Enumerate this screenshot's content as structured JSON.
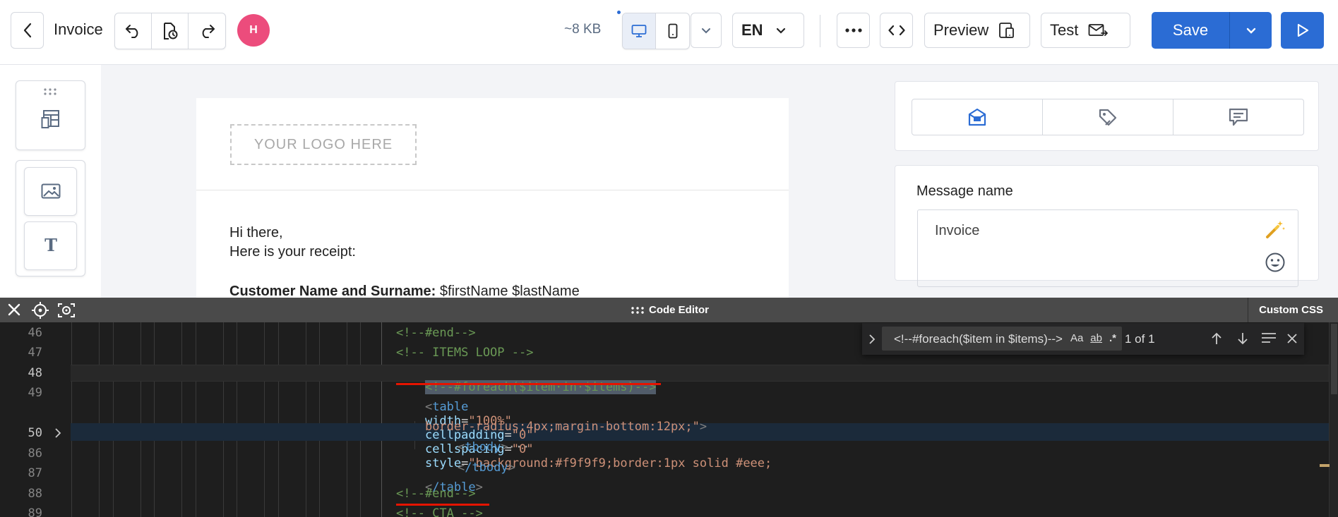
{
  "topbar": {
    "title": "Invoice",
    "avatar_initial": "H",
    "size": "~8 KB",
    "language": "EN",
    "preview_label": "Preview",
    "test_label": "Test",
    "save_label": "Save"
  },
  "canvas": {
    "logo_placeholder": "YOUR LOGO HERE",
    "greeting": "Hi there,",
    "receipt_line": "Here is your receipt:",
    "customer_label": "Customer Name and Surname:",
    "customer_value": "$firstName $lastName"
  },
  "settings": {
    "message_name_label": "Message name",
    "message_name_value": "Invoice"
  },
  "code_editor": {
    "title": "Code Editor",
    "custom_css_label": "Custom CSS",
    "find": {
      "query": "<!--#foreach($item in $items)-->",
      "match_case": "Aa",
      "whole_word": "ab",
      "regex": ".*",
      "count": "1 of 1"
    },
    "lines": [
      {
        "num": "46",
        "text": "<!--#end-->"
      },
      {
        "num": "47",
        "text": "<!-- ITEMS LOOP -->"
      },
      {
        "num": "48",
        "text": "<!--#foreach($item·in·$items)-->"
      },
      {
        "num": "49",
        "tag": "table",
        "attrs": [
          {
            "name": "width",
            "value": "\"100%\""
          },
          {
            "name": "cellpadding",
            "value": "\"0\""
          },
          {
            "name": "cellspacing",
            "value": "\"0\""
          },
          {
            "name": "style",
            "value": "\"background:#f9f9f9;border:1px solid #eee;"
          }
        ]
      },
      {
        "num": "",
        "text": "border-radius:4px;margin-bottom:12px;\""
      },
      {
        "num": "50",
        "tag": "tbody",
        "folded": "···"
      },
      {
        "num": "86",
        "tag": "/tbody"
      },
      {
        "num": "87",
        "tag": "/table"
      },
      {
        "num": "88",
        "text": "<!--#end-->"
      },
      {
        "num": "89",
        "text": "<!-- CTA -->"
      }
    ]
  },
  "colors": {
    "accent": "#2b6cd4",
    "avatar": "#ec4c7c",
    "editor_bg": "#1e1e1e",
    "comment": "#6a9955",
    "tag": "#569cd6",
    "attr": "#9cdcfe",
    "string": "#ce9178",
    "underline": "#e51400"
  },
  "icons": [
    "back-icon",
    "undo-icon",
    "history-icon",
    "redo-icon",
    "desktop-icon",
    "mobile-icon",
    "chevron-down-icon",
    "more-icon",
    "code-icon",
    "preview-device-icon",
    "mail-send-icon",
    "play-icon",
    "layout-icon",
    "image-icon",
    "text-icon",
    "message-settings-icon",
    "tag-icon",
    "comment-icon",
    "magic-wand-icon",
    "emoji-icon",
    "close-icon",
    "target-icon",
    "focus-icon",
    "drag-icon",
    "arrow-up-icon",
    "arrow-down-icon",
    "selection-icon"
  ]
}
